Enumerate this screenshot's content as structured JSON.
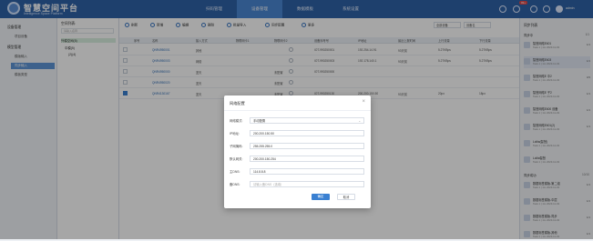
{
  "app": {
    "title": "智慧空间平台",
    "subtitle": "Intelligence Space Platform"
  },
  "nav": {
    "tabs": [
      {
        "label": "扫码管理"
      },
      {
        "label": "设备管理"
      },
      {
        "label": "数据模板"
      },
      {
        "label": "系统设置"
      }
    ],
    "active_index": 1
  },
  "header": {
    "badge": "99+",
    "user": "admin"
  },
  "sidebar": {
    "groups": [
      {
        "label": "设备管理",
        "items": [
          "项目设备"
        ]
      },
      {
        "label": "模型管理",
        "items": [
          "模版输入",
          "同步输入",
          "模板类型"
        ]
      }
    ],
    "active_item": "同步输入"
  },
  "tree": {
    "title": "空间列表:",
    "search_placeholder": "请输入名称",
    "nodes": [
      "外模空间(8)",
      "中模(5)",
      "(2)(4)"
    ]
  },
  "toolbar": {
    "buttons": [
      "刷新",
      "新增",
      "编辑",
      "删除",
      "批量导入",
      "同步配置",
      "更多"
    ],
    "filter1": "全部设备",
    "filter2": "设备名"
  },
  "table": {
    "headers": [
      "序号",
      "名称",
      "接入方式",
      "物联网卡1",
      "物联网卡2",
      "设备序号号",
      "IP地址",
      "最近上报时间",
      "上行流量",
      "下行流量"
    ],
    "rows": [
      [
        "",
        "QNR4950001",
        "其他",
        "",
        "",
        "IOT-990250001",
        "192.254.14.91",
        "93天前",
        "5.27KBps",
        "5.27KBps"
      ],
      [
        "",
        "QNR4950003",
        "网络",
        "",
        "",
        "IOT-990250003",
        "192.178.140.1",
        "93天前",
        "5.27KBps",
        "5.27KBps"
      ],
      [
        "",
        "QNR4950000",
        "蓝天",
        "",
        "未配置",
        "IOT-990250000",
        "",
        "",
        "",
        ""
      ],
      [
        "",
        "QNR4950020",
        "蓝天",
        "",
        "未配置",
        "",
        "",
        "",
        "",
        ""
      ],
      [
        "",
        "QNR4130167",
        "蓝天",
        "",
        "未配置",
        "IOT-990250130",
        "200.200.150.50",
        "93天前",
        "20px",
        "18px"
      ]
    ],
    "checked_row": 4
  },
  "right_panel": {
    "title": "同步列表",
    "section1": {
      "label": "同步中",
      "count": "1/1"
    },
    "items1": [
      {
        "name": "智慧网络E601",
        "desc": "Task 1 | 1m 2023-11-02",
        "count": "1/1"
      },
      {
        "name": "智慧网络E603",
        "desc": "Task 1 | 1m 2023-11-02",
        "count": "1/1"
      },
      {
        "name": "智慧网络E 中2",
        "desc": "Task 1 | 1m 2023-11-02",
        "count": "3/3"
      },
      {
        "name": "智慧网络E 子2",
        "desc": "Task 1 | 1m 2023-11-02",
        "count": "1/1"
      },
      {
        "name": "智慧网络E600 设备",
        "desc": "Task 1 | 1m 2023-11-02",
        "count": "1/1"
      },
      {
        "name": "智慧网络E601(2)",
        "desc": "Task 1 | 1m 2023-11-02",
        "count": "1/1"
      },
      {
        "name": "Lolita(智慧)",
        "desc": "Task 1 | 1m 2023-11-02",
        "count": ""
      },
      {
        "name": "Lolita智慧",
        "desc": "Task 1 | 1m 2023-11-02",
        "count": ""
      }
    ],
    "section2": {
      "label": "同步成功",
      "count": "10/10"
    },
    "items2": [
      {
        "name": "数据标签模版-第二组",
        "desc": "Task 1 | 1m 2023-11-02",
        "count": "1/1"
      },
      {
        "name": "数据标签模版-中层",
        "desc": "Task 1 | 1m 2023-11-02",
        "count": "1/1"
      },
      {
        "name": "数据标签模版-同步",
        "desc": "Task 1 | 1m 2023-11-02",
        "count": "1/1"
      },
      {
        "name": "数据标签模版-其他",
        "desc": "Task 1 | 1m 2023-11-02",
        "count": "1/1"
      }
    ]
  },
  "dialog": {
    "title": "网络配置",
    "fields": [
      {
        "label": "网络模式:",
        "value": "手动配置",
        "placeholder": ""
      },
      {
        "label": "IP地址:",
        "value": "200.200.150.50",
        "placeholder": ""
      },
      {
        "label": "子网掩码:",
        "value": "255.255.255.0",
        "placeholder": ""
      },
      {
        "label": "默认网关:",
        "value": "200.200.150.254",
        "placeholder": ""
      },
      {
        "label": "主DNS:",
        "value": "114.8.8.8",
        "placeholder": ""
      },
      {
        "label": "备DNS:",
        "value": "",
        "placeholder": "请输入备DNS（选填）"
      }
    ],
    "ok": "确定",
    "cancel": "取消"
  },
  "colors": {
    "primary": "#2f63a8",
    "accent": "#3a80d2"
  }
}
